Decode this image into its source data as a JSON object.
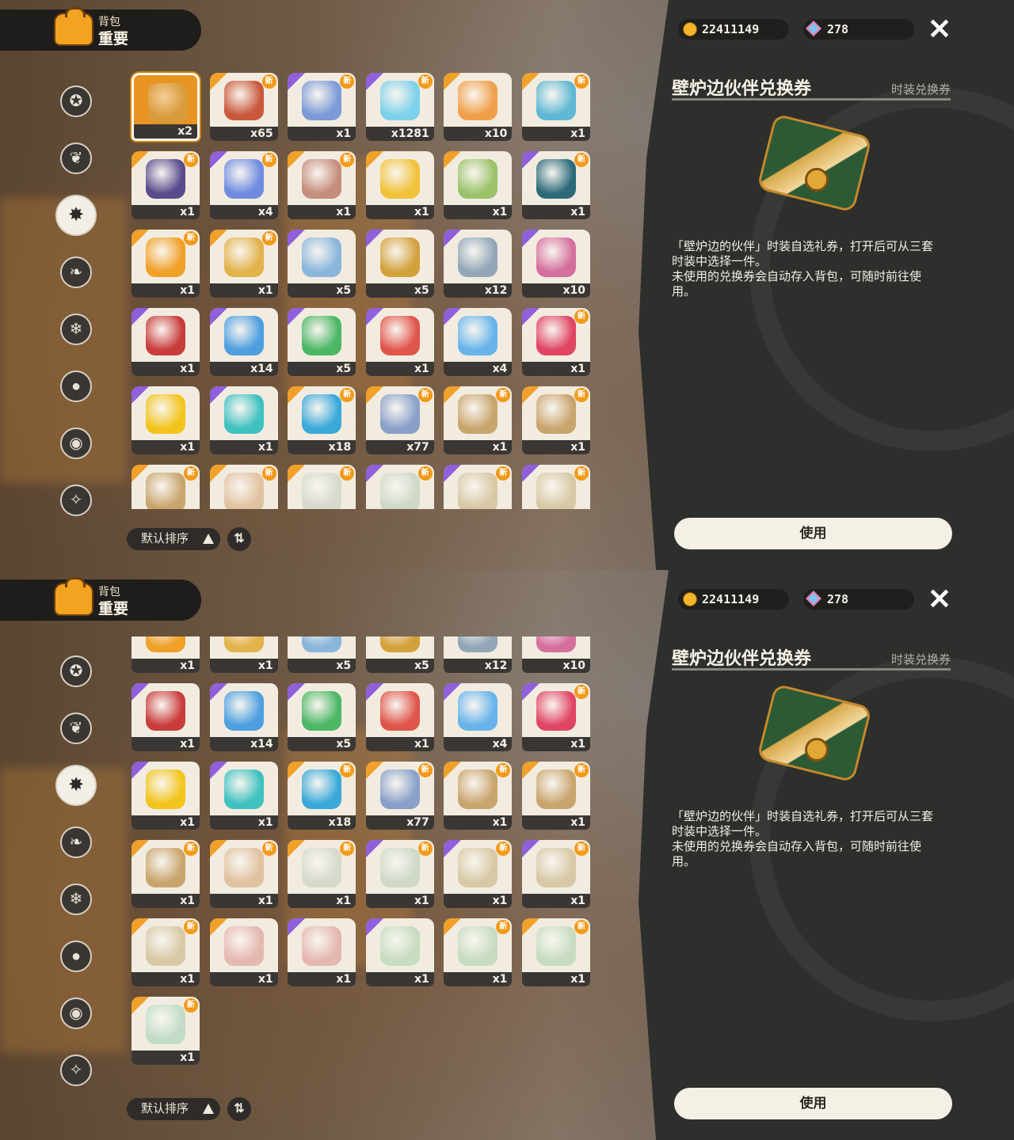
{
  "header": {
    "subtitle": "背包",
    "title": "重要"
  },
  "currencies": {
    "coins": "22411149",
    "gems": "278"
  },
  "detail": {
    "name": "壁炉边伙伴兑换券",
    "type": "时装兑换券",
    "description": "「壁炉边的伙伴」时装自选礼券，打开后可从三套\n时装中选择一件。\n未使用的兑换券会自动存入背包，可随时前往使\n用。",
    "use_label": "使用"
  },
  "sort": {
    "label": "默认排序",
    "toggle_label": "⇅"
  },
  "new_badge": "新",
  "rail_icons": [
    "star-icon",
    "leaf-icon",
    "sparkle-icon",
    "clover-icon",
    "scroll-icon",
    "ball-icon",
    "acorn-icon",
    "chest-icon"
  ],
  "rail_glyphs": [
    "✪",
    "❦",
    "✸",
    "❧",
    "❄",
    "●",
    "◉",
    "✧"
  ],
  "panel1": {
    "rows": [
      [
        {
          "q": "x2",
          "new": false,
          "tier": "orange",
          "sel": true,
          "c": "#d99a3a"
        },
        {
          "q": "x65",
          "new": true,
          "tier": "orange",
          "c": "#c9583d"
        },
        {
          "q": "x1",
          "new": true,
          "tier": "purple",
          "c": "#7b9ad7"
        },
        {
          "q": "x1281",
          "new": true,
          "tier": "purple",
          "c": "#7ed1ea"
        },
        {
          "q": "x10",
          "new": false,
          "tier": "orange",
          "c": "#f0a04b"
        },
        {
          "q": "x1",
          "new": true,
          "tier": "orange",
          "c": "#5fb7d4"
        }
      ],
      [
        {
          "q": "x1",
          "new": true,
          "tier": "orange",
          "c": "#5b4a8c"
        },
        {
          "q": "x4",
          "new": true,
          "tier": "purple",
          "c": "#6e8be0"
        },
        {
          "q": "x1",
          "new": true,
          "tier": "orange",
          "c": "#c48d7c"
        },
        {
          "q": "x1",
          "new": false,
          "tier": "orange",
          "c": "#f2c23a"
        },
        {
          "q": "x1",
          "new": false,
          "tier": "orange",
          "c": "#9bc26b"
        },
        {
          "q": "x1",
          "new": true,
          "tier": "purple",
          "c": "#2c6a7a"
        }
      ],
      [
        {
          "q": "x1",
          "new": true,
          "tier": "orange",
          "c": "#f0a128"
        },
        {
          "q": "x1",
          "new": true,
          "tier": "orange",
          "c": "#e2b24b"
        },
        {
          "q": "x5",
          "new": false,
          "tier": "purple",
          "c": "#8ab6dc"
        },
        {
          "q": "x5",
          "new": false,
          "tier": "purple",
          "c": "#d3a13c"
        },
        {
          "q": "x12",
          "new": false,
          "tier": "purple",
          "c": "#93a6b8"
        },
        {
          "q": "x10",
          "new": false,
          "tier": "purple",
          "c": "#d46f9d"
        }
      ],
      [
        {
          "q": "x1",
          "new": false,
          "tier": "purple",
          "c": "#c93c3c"
        },
        {
          "q": "x14",
          "new": false,
          "tier": "purple",
          "c": "#4d9fe0"
        },
        {
          "q": "x5",
          "new": false,
          "tier": "purple",
          "c": "#4cb765"
        },
        {
          "q": "x1",
          "new": false,
          "tier": "purple",
          "c": "#e0554a"
        },
        {
          "q": "x4",
          "new": false,
          "tier": "purple",
          "c": "#68b4ea"
        },
        {
          "q": "x1",
          "new": true,
          "tier": "purple",
          "c": "#e04563"
        }
      ],
      [
        {
          "q": "x1",
          "new": false,
          "tier": "purple",
          "c": "#f2c41c"
        },
        {
          "q": "x1",
          "new": false,
          "tier": "purple",
          "c": "#3fc1c0"
        },
        {
          "q": "x18",
          "new": true,
          "tier": "orange",
          "c": "#3aa9d9"
        },
        {
          "q": "x77",
          "new": true,
          "tier": "orange",
          "c": "#8aa0c8"
        },
        {
          "q": "x1",
          "new": true,
          "tier": "orange",
          "c": "#c9a56e"
        },
        {
          "q": "x1",
          "new": true,
          "tier": "orange",
          "c": "#c9a56e"
        }
      ],
      [
        {
          "q": "",
          "new": true,
          "tier": "orange",
          "c": "#c9a56e"
        },
        {
          "q": "",
          "new": true,
          "tier": "orange",
          "c": "#e1c2a0"
        },
        {
          "q": "",
          "new": true,
          "tier": "orange",
          "c": "#d6d9cc"
        },
        {
          "q": "",
          "new": true,
          "tier": "purple",
          "c": "#cfd9c8"
        },
        {
          "q": "",
          "new": true,
          "tier": "purple",
          "c": "#d8c9a6"
        },
        {
          "q": "",
          "new": true,
          "tier": "purple",
          "c": "#d8c9a6"
        }
      ]
    ]
  },
  "panel2": {
    "rows": [
      [
        {
          "q": "x1",
          "new": false,
          "tier": "orange",
          "c": "#f0a128"
        },
        {
          "q": "x1",
          "new": false,
          "tier": "orange",
          "c": "#e2b24b"
        },
        {
          "q": "x5",
          "new": false,
          "tier": "purple",
          "c": "#8ab6dc"
        },
        {
          "q": "x5",
          "new": false,
          "tier": "purple",
          "c": "#d3a13c"
        },
        {
          "q": "x12",
          "new": false,
          "tier": "purple",
          "c": "#93a6b8"
        },
        {
          "q": "x10",
          "new": false,
          "tier": "purple",
          "c": "#d46f9d"
        }
      ],
      [
        {
          "q": "x1",
          "new": false,
          "tier": "purple",
          "c": "#c93c3c"
        },
        {
          "q": "x14",
          "new": false,
          "tier": "purple",
          "c": "#4d9fe0"
        },
        {
          "q": "x5",
          "new": false,
          "tier": "purple",
          "c": "#4cb765"
        },
        {
          "q": "x1",
          "new": false,
          "tier": "purple",
          "c": "#e0554a"
        },
        {
          "q": "x4",
          "new": false,
          "tier": "purple",
          "c": "#68b4ea"
        },
        {
          "q": "x1",
          "new": true,
          "tier": "purple",
          "c": "#e04563"
        }
      ],
      [
        {
          "q": "x1",
          "new": false,
          "tier": "purple",
          "c": "#f2c41c"
        },
        {
          "q": "x1",
          "new": false,
          "tier": "purple",
          "c": "#3fc1c0"
        },
        {
          "q": "x18",
          "new": true,
          "tier": "orange",
          "c": "#3aa9d9"
        },
        {
          "q": "x77",
          "new": true,
          "tier": "orange",
          "c": "#8aa0c8"
        },
        {
          "q": "x1",
          "new": true,
          "tier": "orange",
          "c": "#c9a56e"
        },
        {
          "q": "x1",
          "new": true,
          "tier": "orange",
          "c": "#c9a56e"
        }
      ],
      [
        {
          "q": "x1",
          "new": true,
          "tier": "orange",
          "c": "#c9a56e"
        },
        {
          "q": "x1",
          "new": true,
          "tier": "orange",
          "c": "#e1c2a0"
        },
        {
          "q": "x1",
          "new": true,
          "tier": "orange",
          "c": "#d6d9cc"
        },
        {
          "q": "x1",
          "new": true,
          "tier": "purple",
          "c": "#cfd9c8"
        },
        {
          "q": "x1",
          "new": true,
          "tier": "purple",
          "c": "#d8c9a6"
        },
        {
          "q": "x1",
          "new": true,
          "tier": "purple",
          "c": "#d8c9a6"
        }
      ],
      [
        {
          "q": "x1",
          "new": true,
          "tier": "orange",
          "c": "#d8c9a6"
        },
        {
          "q": "x1",
          "new": false,
          "tier": "orange",
          "c": "#e4b8b0"
        },
        {
          "q": "x1",
          "new": false,
          "tier": "purple",
          "c": "#e4b8b0"
        },
        {
          "q": "x1",
          "new": false,
          "tier": "purple",
          "c": "#c7dcc0"
        },
        {
          "q": "x1",
          "new": true,
          "tier": "orange",
          "c": "#c7dcc0"
        },
        {
          "q": "x1",
          "new": true,
          "tier": "orange",
          "c": "#c7dcc0"
        }
      ],
      [
        {
          "q": "x1",
          "new": true,
          "tier": "orange",
          "c": "#c2dcc8"
        }
      ]
    ]
  }
}
